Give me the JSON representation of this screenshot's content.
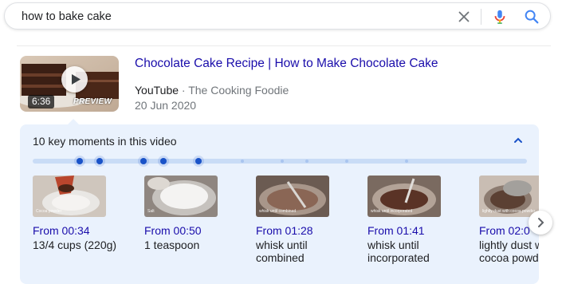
{
  "search": {
    "query": "how to bake cake"
  },
  "result": {
    "duration": "6:36",
    "preview_label": "PREVIEW",
    "title": "Chocolate Cake Recipe | How to Make Chocolate Cake",
    "site": "YouTube",
    "separator": " · ",
    "channel": "The Cooking Foodie",
    "date": "20 Jun 2020"
  },
  "key_moments": {
    "header": "10 key moments in this video",
    "moments": [
      {
        "time": "From 00:34",
        "label": "13/4 cups (220g)",
        "thumb_caption": "Cocoa powder"
      },
      {
        "time": "From 00:50",
        "label": "1 teaspoon",
        "thumb_caption": "Salt"
      },
      {
        "time": "From 01:28",
        "label": "whisk until combined",
        "thumb_caption": "whisk until combined"
      },
      {
        "time": "From 01:41",
        "label": "whisk until incorporated",
        "thumb_caption": "whisk until incorporated"
      },
      {
        "time": "From 02:0",
        "label": "lightly dust with cocoa powder",
        "thumb_caption": "lightly dust with cocoa powder"
      }
    ]
  },
  "colors": {
    "link": "#1a0dab",
    "panel_bg": "#eaf2fd",
    "marker_active": "#1a53c8",
    "mic_blue": "#4285f4",
    "mic_red": "#ea4335"
  }
}
